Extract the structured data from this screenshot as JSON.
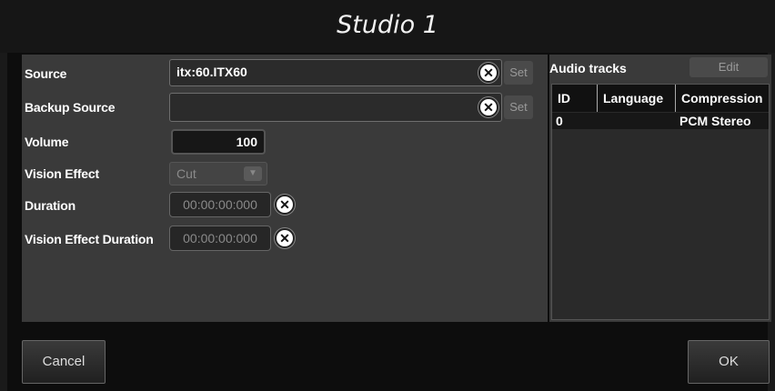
{
  "dialog": {
    "title": "Studio 1"
  },
  "fields": {
    "source": {
      "label": "Source",
      "value": "itx:60.ITX60",
      "set_label": "Set"
    },
    "backup_source": {
      "label": "Backup Source",
      "value": "",
      "set_label": "Set"
    },
    "volume": {
      "label": "Volume",
      "value": "100"
    },
    "vision_effect": {
      "label": "Vision Effect",
      "value": "Cut"
    },
    "duration": {
      "label": "Duration",
      "value": "00:00:00:000"
    },
    "vision_effect_duration": {
      "label": "Vision Effect Duration",
      "value": "00:00:00:000"
    }
  },
  "audio_tracks": {
    "title": "Audio tracks",
    "edit_label": "Edit",
    "columns": [
      "ID",
      "Language",
      "Compression"
    ],
    "rows": [
      {
        "id": "0",
        "language": "",
        "compression": "PCM Stereo"
      }
    ]
  },
  "footer": {
    "cancel_label": "Cancel",
    "ok_label": "OK"
  },
  "icons": {
    "clear": "close-circle-icon",
    "dropdown": "chevron-down-icon"
  },
  "colors": {
    "panel": "#3a3a3a",
    "background": "#1a1a1a",
    "text": "#ffffff",
    "disabled_text": "#8a8a8a"
  }
}
